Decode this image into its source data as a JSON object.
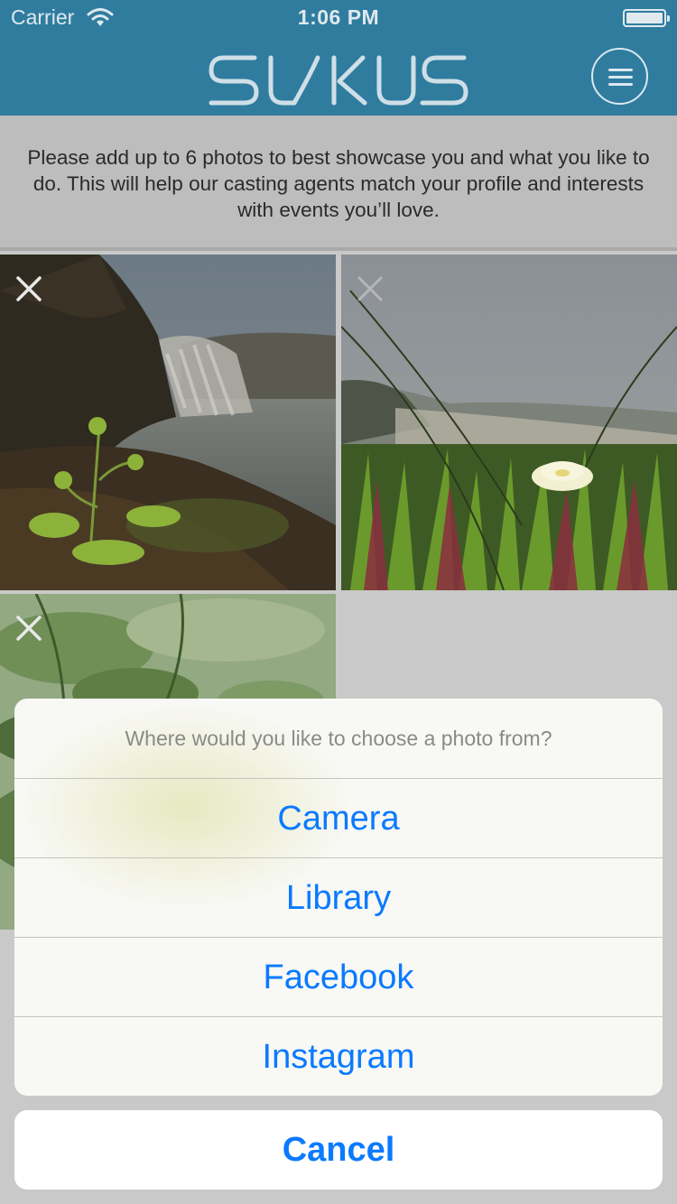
{
  "status_bar": {
    "carrier": "Carrier",
    "time": "1:06 PM"
  },
  "header": {
    "logo_text": "SUKUS",
    "menu_icon": "hamburger-menu-icon"
  },
  "intro_text": "Please add up to 6 photos to best showcase you and what you like to do. This will help our casting agents match your profile and interests with events you’ll love.",
  "photos": [
    {
      "subject": "waterfall"
    },
    {
      "subject": "flower-grass"
    },
    {
      "subject": "green-leaves"
    }
  ],
  "action_sheet": {
    "title": "Where would you like to choose a photo from?",
    "options": [
      "Camera",
      "Library",
      "Facebook",
      "Instagram"
    ],
    "cancel": "Cancel"
  },
  "colors": {
    "nav": "#2f7c9f",
    "accent": "#0a7aff"
  }
}
